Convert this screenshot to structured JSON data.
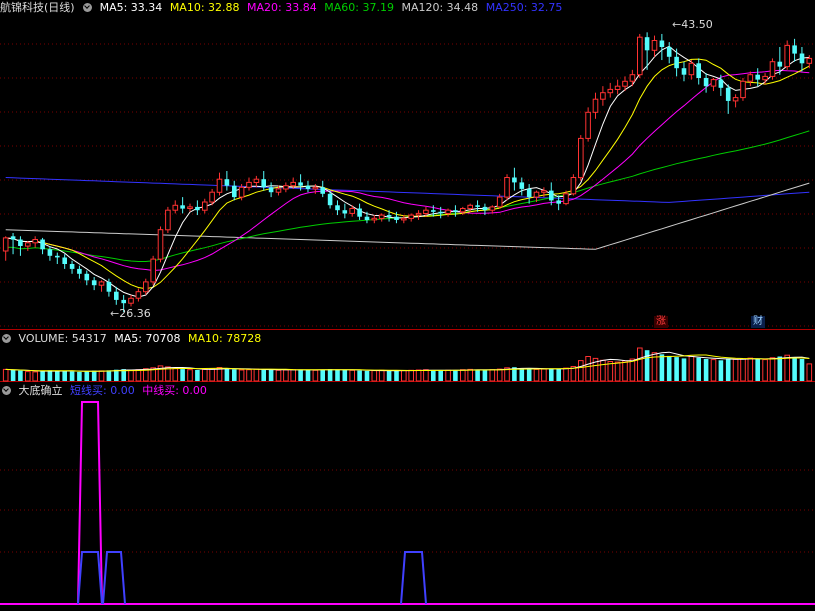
{
  "main_header": {
    "title": "航锦科技(日线)",
    "ma": [
      {
        "label": "MA5: 33.34",
        "color": "#ffffff"
      },
      {
        "label": "MA10: 32.88",
        "color": "#ffff00"
      },
      {
        "label": "MA20: 33.84",
        "color": "#ff00ff"
      },
      {
        "label": "MA60: 37.19",
        "color": "#00cc00"
      },
      {
        "label": "MA120: 34.48",
        "color": "#cccccc"
      },
      {
        "label": "MA250: 32.75",
        "color": "#3333ff"
      }
    ]
  },
  "volume_header": {
    "label": "VOLUME: 54317",
    "ma5": "MA5: 70708",
    "ma10": "MA10: 78728"
  },
  "indicator_header": {
    "name": "大底确立",
    "s1": "短线买: 0.00",
    "s2": "中线买: 0.00"
  },
  "annotations": {
    "high_label": "43.50",
    "low_label": "26.36",
    "badge1": "涨",
    "badge2": "财"
  },
  "colors": {
    "up": "#ff3232",
    "down": "#54fcfc",
    "grid": "#7a0000",
    "ma5": "#ffffff",
    "ma10": "#ffff00",
    "ma20": "#ff00ff",
    "ma60": "#00cc00",
    "ma120": "#cccccc",
    "ma250": "#3333ff",
    "short_buy": "#4040ff",
    "mid_buy": "#ff00ff"
  },
  "chart_data": {
    "type": "candlestick",
    "ohlc": [
      [
        30.1,
        31.0,
        30.9,
        29.5
      ],
      [
        31.0,
        31.2,
        30.8,
        29.9
      ],
      [
        30.8,
        31.0,
        30.4,
        29.8
      ],
      [
        30.4,
        30.7,
        30.6,
        30.1
      ],
      [
        30.6,
        31.0,
        30.8,
        30.3
      ],
      [
        30.8,
        30.9,
        30.2,
        29.9
      ],
      [
        30.2,
        30.4,
        29.8,
        29.5
      ],
      [
        29.8,
        30.0,
        29.7,
        29.3
      ],
      [
        29.7,
        29.9,
        29.3,
        29.0
      ],
      [
        29.3,
        29.5,
        29.0,
        28.7
      ],
      [
        29.0,
        29.2,
        28.7,
        28.4
      ],
      [
        28.7,
        28.9,
        28.3,
        28.0
      ],
      [
        28.3,
        28.5,
        28.0,
        27.7
      ],
      [
        28.0,
        28.3,
        28.2,
        27.6
      ],
      [
        28.2,
        28.4,
        27.6,
        27.3
      ],
      [
        27.6,
        27.9,
        27.1,
        26.8
      ],
      [
        27.1,
        27.4,
        26.9,
        26.36
      ],
      [
        26.9,
        27.4,
        27.2,
        26.7
      ],
      [
        27.2,
        27.8,
        27.6,
        27.0
      ],
      [
        27.6,
        28.4,
        28.2,
        27.4
      ],
      [
        28.2,
        29.8,
        29.6,
        28.0
      ],
      [
        29.6,
        31.6,
        31.4,
        29.4
      ],
      [
        31.4,
        32.8,
        32.6,
        31.2
      ],
      [
        32.6,
        33.2,
        32.9,
        32.4
      ],
      [
        32.9,
        33.4,
        32.7,
        32.4
      ],
      [
        32.7,
        33.0,
        32.8,
        32.5
      ],
      [
        32.8,
        33.2,
        32.6,
        32.3
      ],
      [
        32.6,
        33.3,
        33.1,
        32.4
      ],
      [
        33.1,
        33.9,
        33.7,
        32.9
      ],
      [
        33.7,
        34.9,
        34.5,
        33.5
      ],
      [
        34.5,
        35.0,
        34.1,
        33.8
      ],
      [
        34.1,
        34.4,
        33.4,
        33.2
      ],
      [
        33.4,
        34.2,
        34.0,
        33.2
      ],
      [
        34.0,
        34.6,
        34.3,
        33.8
      ],
      [
        34.3,
        34.7,
        34.5,
        34.0
      ],
      [
        34.5,
        35.0,
        34.0,
        33.8
      ],
      [
        34.0,
        34.3,
        33.7,
        33.4
      ],
      [
        33.7,
        34.1,
        33.9,
        33.5
      ],
      [
        33.9,
        34.3,
        34.1,
        33.7
      ],
      [
        34.1,
        34.6,
        34.3,
        33.9
      ],
      [
        34.3,
        34.8,
        34.1,
        33.8
      ],
      [
        34.1,
        34.4,
        33.9,
        33.7
      ],
      [
        33.9,
        34.2,
        34.0,
        33.6
      ],
      [
        34.0,
        34.4,
        33.6,
        33.4
      ],
      [
        33.6,
        33.8,
        32.9,
        32.7
      ],
      [
        32.9,
        33.2,
        32.6,
        32.3
      ],
      [
        32.6,
        33.0,
        32.4,
        32.1
      ],
      [
        32.4,
        32.9,
        32.7,
        32.2
      ],
      [
        32.7,
        33.0,
        32.2,
        32.0
      ],
      [
        32.2,
        32.5,
        32.0,
        31.8
      ],
      [
        32.0,
        32.3,
        32.1,
        31.8
      ],
      [
        32.1,
        32.4,
        32.3,
        31.9
      ],
      [
        32.3,
        32.6,
        32.2,
        31.9
      ],
      [
        32.2,
        32.5,
        32.0,
        31.8
      ],
      [
        32.0,
        32.3,
        32.1,
        31.8
      ],
      [
        32.1,
        32.4,
        32.3,
        31.9
      ],
      [
        32.3,
        32.6,
        32.4,
        32.0
      ],
      [
        32.4,
        32.8,
        32.6,
        32.2
      ],
      [
        32.6,
        32.9,
        32.5,
        32.2
      ],
      [
        32.5,
        32.8,
        32.4,
        32.1
      ],
      [
        32.4,
        32.7,
        32.6,
        32.2
      ],
      [
        32.6,
        32.9,
        32.5,
        32.2
      ],
      [
        32.5,
        32.8,
        32.7,
        32.3
      ],
      [
        32.7,
        33.0,
        32.9,
        32.5
      ],
      [
        32.9,
        33.2,
        32.8,
        32.5
      ],
      [
        32.8,
        33.0,
        32.6,
        32.3
      ],
      [
        32.6,
        32.9,
        32.8,
        32.4
      ],
      [
        32.8,
        33.6,
        33.4,
        32.7
      ],
      [
        33.4,
        34.8,
        34.6,
        33.2
      ],
      [
        34.6,
        35.2,
        34.3,
        33.8
      ],
      [
        34.3,
        34.6,
        33.9,
        33.5
      ],
      [
        33.9,
        34.2,
        33.4,
        33.0
      ],
      [
        33.4,
        33.8,
        33.7,
        33.1
      ],
      [
        33.7,
        34.0,
        33.8,
        33.4
      ],
      [
        33.8,
        34.3,
        33.2,
        32.9
      ],
      [
        33.2,
        33.5,
        33.0,
        32.6
      ],
      [
        33.0,
        33.8,
        33.6,
        32.9
      ],
      [
        33.6,
        34.8,
        34.6,
        33.5
      ],
      [
        34.6,
        37.2,
        37.0,
        34.4
      ],
      [
        37.0,
        38.9,
        38.6,
        36.8
      ],
      [
        38.6,
        39.8,
        39.4,
        38.2
      ],
      [
        39.4,
        40.2,
        39.8,
        39.0
      ],
      [
        39.8,
        40.4,
        40.0,
        39.5
      ],
      [
        40.0,
        40.6,
        40.2,
        39.7
      ],
      [
        40.2,
        40.8,
        40.5,
        39.9
      ],
      [
        40.5,
        41.2,
        40.9,
        40.2
      ],
      [
        40.9,
        43.4,
        43.2,
        40.7
      ],
      [
        43.2,
        43.5,
        42.4,
        41.2
      ],
      [
        42.4,
        43.3,
        43.0,
        42.0
      ],
      [
        43.0,
        43.4,
        42.6,
        41.8
      ],
      [
        42.6,
        42.9,
        42.0,
        41.6
      ],
      [
        42.0,
        42.5,
        41.3,
        40.8
      ],
      [
        41.3,
        41.7,
        40.9,
        40.5
      ],
      [
        40.9,
        41.8,
        41.6,
        40.6
      ],
      [
        41.6,
        41.9,
        40.7,
        40.3
      ],
      [
        40.7,
        41.0,
        40.2,
        39.8
      ],
      [
        40.2,
        40.7,
        40.6,
        39.9
      ],
      [
        40.6,
        40.9,
        40.1,
        39.6
      ],
      [
        40.1,
        40.3,
        39.3,
        38.5
      ],
      [
        39.3,
        39.7,
        39.5,
        38.9
      ],
      [
        39.5,
        40.7,
        40.5,
        39.3
      ],
      [
        40.5,
        41.1,
        40.9,
        40.2
      ],
      [
        40.9,
        41.3,
        40.6,
        40.2
      ],
      [
        40.6,
        41.0,
        40.8,
        40.3
      ],
      [
        40.8,
        41.9,
        41.7,
        40.6
      ],
      [
        41.7,
        42.6,
        41.4,
        40.9
      ],
      [
        41.4,
        43.0,
        42.7,
        41.2
      ],
      [
        42.7,
        43.1,
        42.2,
        41.7
      ],
      [
        42.2,
        42.6,
        41.6,
        41.1
      ],
      [
        41.6,
        42.1,
        41.9,
        41.3
      ]
    ],
    "volume": [
      37000,
      35000,
      33000,
      30000,
      29000,
      31000,
      34000,
      33000,
      32000,
      30000,
      29000,
      31000,
      33000,
      32000,
      34000,
      36000,
      38000,
      35000,
      36000,
      39000,
      42000,
      48000,
      45000,
      41000,
      38000,
      36000,
      35000,
      37000,
      39000,
      43000,
      41000,
      37000,
      35000,
      36000,
      38000,
      37000,
      35000,
      34000,
      35000,
      36000,
      37000,
      35000,
      34000,
      36000,
      38000,
      37000,
      35000,
      34000,
      33000,
      32000,
      33000,
      34000,
      33000,
      32000,
      33000,
      34000,
      35000,
      36000,
      34000,
      33000,
      34000,
      35000,
      36000,
      37000,
      36000,
      35000,
      36000,
      38000,
      42000,
      44000,
      40000,
      38000,
      37000,
      38000,
      40000,
      39000,
      41000,
      46000,
      65000,
      78000,
      72000,
      66000,
      62000,
      60000,
      64000,
      70000,
      105000,
      98000,
      90000,
      85000,
      80000,
      76000,
      72000,
      78000,
      74000,
      70000,
      68000,
      66000,
      72000,
      69000,
      71000,
      73000,
      70000,
      68000,
      74000,
      78000,
      82000,
      76000,
      70000,
      54317
    ],
    "signals": {
      "mid_buy": {
        "name": "中线买",
        "values": [
          [
            82,
            87,
            1
          ],
          [
            87,
            92,
            1
          ]
        ]
      },
      "short_buy": {
        "name": "短线买",
        "values": [
          [
            82,
            92,
            1
          ],
          [
            102,
            116,
            1
          ],
          [
            400,
            420,
            1
          ]
        ]
      }
    },
    "ylim_price": [
      25.5,
      44.5
    ],
    "last_ma": {
      "MA5": 33.34,
      "MA10": 32.88,
      "MA20": 33.84,
      "MA60": 37.19,
      "MA120": 34.48,
      "MA250": 32.75
    }
  }
}
